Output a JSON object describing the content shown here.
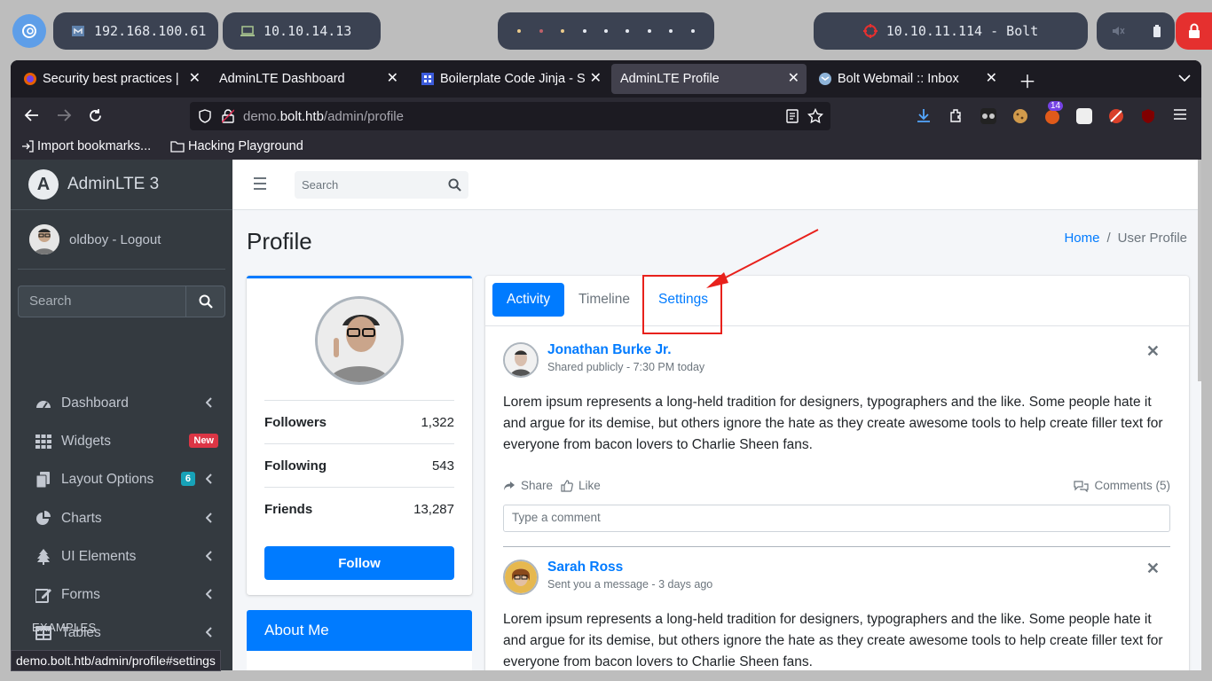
{
  "desktop": {
    "vpn_ip": "192.168.100.61",
    "local_ip": "10.10.14.13",
    "target": "10.10.11.114 - Bolt",
    "workspace_colors": [
      "#ebcb8b",
      "#bf616a",
      "#ebcb8b",
      "#e5e9f0",
      "#e5e9f0",
      "#e5e9f0",
      "#e5e9f0",
      "#e5e9f0",
      "#e5e9f0"
    ]
  },
  "browser": {
    "tabs": [
      {
        "label": "Security best practices |",
        "active": false
      },
      {
        "label": "AdminLTE Dashboard",
        "active": false
      },
      {
        "label": "Boilerplate Code Jinja - S",
        "active": false
      },
      {
        "label": "AdminLTE Profile",
        "active": true
      },
      {
        "label": "Bolt Webmail :: Inbox",
        "active": false
      }
    ],
    "url_prefix": "demo.",
    "url_domain": "bolt.htb",
    "url_path": "/admin/profile",
    "extension_badge": "14",
    "bookmarks": [
      "Import bookmarks...",
      "Hacking Playground"
    ],
    "status_link": "demo.bolt.htb/admin/profile#settings"
  },
  "sidebar": {
    "brand": "AdminLTE 3",
    "user": "oldboy - Logout",
    "search_placeholder": "Search",
    "items": [
      {
        "label": "Dashboard",
        "icon": "dashboard-icon",
        "chevron": true
      },
      {
        "label": "Widgets",
        "icon": "grid-icon",
        "badge": "New",
        "badge_color": "#dc3545"
      },
      {
        "label": "Layout Options",
        "icon": "copy-icon",
        "badge": "6",
        "badge_color": "#17a2b8",
        "chevron": true
      },
      {
        "label": "Charts",
        "icon": "pie-chart-icon",
        "chevron": true
      },
      {
        "label": "UI Elements",
        "icon": "tree-icon",
        "chevron": true
      },
      {
        "label": "Forms",
        "icon": "edit-icon",
        "chevron": true
      },
      {
        "label": "Tables",
        "icon": "table-icon",
        "chevron": true
      }
    ],
    "section_header": "EXAMPLES"
  },
  "header": {
    "search_placeholder": "Search"
  },
  "content": {
    "title": "Profile",
    "breadcrumb_home": "Home",
    "breadcrumb_sep": "/",
    "breadcrumb_current": "User Profile"
  },
  "profile_card": {
    "stats": [
      {
        "label": "Followers",
        "value": "1,322"
      },
      {
        "label": "Following",
        "value": "543"
      },
      {
        "label": "Friends",
        "value": "13,287"
      }
    ],
    "follow_label": "Follow",
    "about_title": "About Me"
  },
  "main_card": {
    "tabs": [
      "Activity",
      "Timeline",
      "Settings"
    ],
    "posts": [
      {
        "user": "Jonathan Burke Jr.",
        "desc": "Shared publicly - 7:30 PM today",
        "text": "Lorem ipsum represents a long-held tradition for designers, typographers and the like. Some people hate it and argue for its demise, but others ignore the hate as they create awesome tools to help create filler text for everyone from bacon lovers to Charlie Sheen fans.",
        "share": "Share",
        "like": "Like",
        "comments": "Comments (5)",
        "comment_placeholder": "Type a comment"
      },
      {
        "user": "Sarah Ross",
        "desc": "Sent you a message - 3 days ago",
        "text": "Lorem ipsum represents a long-held tradition for designers, typographers and the like. Some people hate it and argue for its demise, but others ignore the hate as they create awesome tools to help create filler text for everyone from bacon lovers to Charlie Sheen fans."
      }
    ]
  },
  "annotation_color": "#e8211c"
}
